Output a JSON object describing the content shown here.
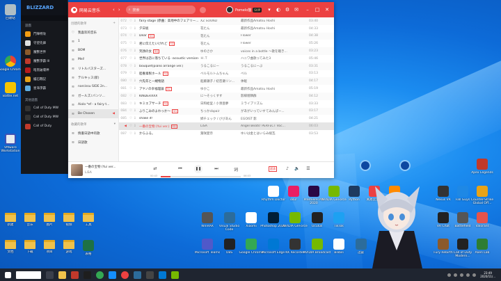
{
  "blizzard": {
    "logo": "BLIZZARD",
    "top_label": "遊戲",
    "section_games": "遊戲",
    "games": [
      {
        "label": "鬥陣特攻",
        "color": "#f39c12"
      },
      {
        "label": "守望先鋒",
        "color": "#e0e0e0"
      },
      {
        "label": "魔獸世界",
        "color": "#8b5a2b"
      },
      {
        "label": "魔獸爭霸 III",
        "color": "#c0392b"
      },
      {
        "label": "暗黑破壞神",
        "color": "#b71c1c"
      },
      {
        "label": "爐石戰記",
        "color": "#e8a317"
      },
      {
        "label": "星海爭霸",
        "color": "#5dade2"
      }
    ],
    "section_other": "其他遊戲",
    "other_games": [
      {
        "label": "Call of Duty MW",
        "color": "#333333"
      },
      {
        "label": "Call of Duty MW",
        "color": "#333333"
      },
      {
        "label": "Call of Duty",
        "color": "#c0392b"
      }
    ]
  },
  "netease": {
    "app_name": "网易云音乐",
    "search_placeholder": "搜索",
    "user_name": "Pomelo猫",
    "vip": "SVIP",
    "sidebar_section_created": "创建的歌单",
    "sidebar_items": [
      {
        "icon": "♡",
        "label": "我喜欢的音乐"
      },
      {
        "icon": "≋",
        "label": "1"
      },
      {
        "icon": "≋",
        "label": "BOM"
      },
      {
        "icon": "≋",
        "label": "Mei!"
      },
      {
        "icon": "≋",
        "label": "リトルバスターズ..."
      },
      {
        "icon": "≋",
        "label": "テルキッス(新)"
      },
      {
        "icon": "≋",
        "label": "narcissu SIDE 2n..."
      },
      {
        "icon": "≋",
        "label": "ガールズ♪バンソ..."
      },
      {
        "icon": "≋",
        "label": "Aiolo *ef - a fairy t..."
      },
      {
        "icon": "≋",
        "label": "Be Chosen"
      }
    ],
    "sidebar_section_collected": "收藏的歌单",
    "sidebar_collected": [
      {
        "icon": "≋",
        "label": "情書日語中的歌"
      },
      {
        "icon": "≋",
        "label": "日語歌"
      }
    ],
    "songs": [
      {
        "no": "072",
        "title": "fairy stage (原曲：高地中のフェアリー...",
        "tag": "",
        "artist": "XZ SOUND",
        "album": "最新作品Amatsu Hoshi",
        "duration": "03:40"
      },
      {
        "no": "073",
        "title": "夕日坂",
        "tag": "",
        "artist": "花たん",
        "album": "最新作品Amatsu Hoshi",
        "duration": "04:33"
      },
      {
        "no": "074",
        "title": "Dear",
        "tag": "SQ",
        "artist": "花たん",
        "album": "Flower",
        "duration": "04:38"
      },
      {
        "no": "075",
        "title": "君に伝えたいけれど",
        "tag": "SQ",
        "artist": "花たん",
        "album": "Flower",
        "duration": "05:26"
      },
      {
        "no": "076",
        "title": "笑顔の女",
        "tag": "SQ",
        "artist": "ゆのさか",
        "album": "voices in a bottle ～歌を聴き...",
        "duration": "03:23"
      },
      {
        "no": "077",
        "title": "世界は恋に落ちている -acoustic version-",
        "tag": "",
        "artist": "Ｈ.Ｔ",
        "album": "ハニワ曲歌ってみた3",
        "duration": "05:46"
      },
      {
        "no": "078",
        "title": "bouquet(piano arrange ver.)",
        "tag": "",
        "artist": "うるこるにー",
        "album": "うるこるにーぶ",
        "duration": "03:31"
      },
      {
        "no": "079",
        "title": "胆養毒製ホール",
        "tag": "SQ",
        "artist": "ベルモルトムちゃん",
        "album": "ベル",
        "duration": "03:13"
      },
      {
        "no": "080",
        "title": "穴先年と一緒物語",
        "tag": "",
        "artist": "船藤瀬子 / 初音瀬リン...",
        "album": "休眠",
        "duration": "04:17"
      },
      {
        "no": "081",
        "title": "アヤノの幸福理論",
        "tag": "SQ",
        "artist": "ゆかこ",
        "album": "最新作品Amatsu Hoshi",
        "duration": "05:19"
      },
      {
        "no": "082",
        "title": "KINDERXXX",
        "tag": "",
        "artist": "に～そっくすす",
        "album": "影縁貌隣群",
        "duration": "04:12"
      },
      {
        "no": "083",
        "title": "キミエブサーチ",
        "tag": "SQ",
        "artist": "日和絵里 / 小湊亜夢",
        "album": "ミライプリズム",
        "duration": "03:33"
      },
      {
        "no": "084",
        "title": "ふりこみのよわっか～",
        "tag": "SQ",
        "artist": "ちっかcbpair",
        "album": "があがいっていすてみんぱー...",
        "duration": "03:17"
      },
      {
        "no": "085",
        "title": "shake it!",
        "tag": "",
        "artist": "姉チェック / びびあん",
        "album": "EGOIST 影",
        "duration": "04:21"
      },
      {
        "no": "086",
        "title": "一番の宝物 (Yui ver.)",
        "tag": "SQ",
        "artist": "LiSA",
        "album": "Angel Beats! PERFECT Voc...",
        "duration": "06:03"
      },
      {
        "no": "087",
        "title": "からふる。",
        "tag": "",
        "artist": "葉咲愛奈",
        "album": "ゆいは金とはいらみ綾瓦",
        "duration": "03:53"
      }
    ],
    "playing_index": 14,
    "player": {
      "title": "一番の宝物 (Yui ver...",
      "artist": "LiSA",
      "current": "00:43",
      "total": "06:03",
      "progress": 0.12,
      "quality": "超清"
    }
  },
  "desktop": {
    "left_icons": [
      {
        "label": "回收站",
        "color": "#b0bec5"
      },
      {
        "label": "Google Chrome",
        "color": "#34a853"
      },
      {
        "label": "Battle.net",
        "color": "#148eff"
      },
      {
        "label": "VMware Workstation",
        "color": "#e7ecf0"
      }
    ],
    "center_icons_row1": [
      {
        "label": "Rhythm Doctor",
        "color": "#ffffff"
      },
      {
        "label": "osu!",
        "color": "#e91e63"
      },
      {
        "label": "Premiere Pro 2020",
        "color": "#2a0845"
      },
      {
        "label": "NVIDIA GeForce",
        "color": "#76b900"
      },
      {
        "label": "Python",
        "color": "#1e3a5f"
      },
      {
        "label": "网易云音乐",
        "color": "#ec4141"
      },
      {
        "label": "Steam",
        "color": "#ff8a00"
      }
    ],
    "center_icons_row2": [
      {
        "label": "WinRAR",
        "color": "#555555"
      },
      {
        "label": "Visual Studio Code",
        "color": "#2c6c9b"
      },
      {
        "label": "Xiaomi",
        "color": "#ffffff"
      },
      {
        "label": "Photoshop 2020",
        "color": "#001e36"
      },
      {
        "label": "NVIDIA GeForce",
        "color": "#76b900"
      },
      {
        "label": "Oculus",
        "color": "#222222"
      },
      {
        "label": "TikTok",
        "color": "#1da1f2"
      }
    ],
    "center_icons_row3": [
      {
        "label": "Microsoft Teams",
        "color": "#5059c9"
      },
      {
        "label": "OBS",
        "color": "#222222"
      },
      {
        "label": "Google Chrome",
        "color": "#34a853"
      },
      {
        "label": "Microsoft Edge",
        "color": "#0078d4"
      },
      {
        "label": "KK Recorder",
        "color": "#333333"
      },
      {
        "label": "NVIDIA Broadcast",
        "color": "#76b900"
      },
      {
        "label": "Bilibili",
        "color": "#ffffff"
      },
      {
        "label": "迅雷",
        "color": "#2c6c9b"
      }
    ],
    "right_icons": [
      {
        "label": "Apex Legends",
        "color": "#c0392b"
      },
      {
        "label": "Nexus VR",
        "color": "#333333"
      },
      {
        "label": "Fall Guys",
        "color": "#1e88e5"
      },
      {
        "label": "Counter-Strike Global Off...",
        "color": "#e8a317"
      },
      {
        "label": "VR Chat",
        "color": "#222222"
      },
      {
        "label": "Battlefield",
        "color": "#555555"
      },
      {
        "label": "Valorant",
        "color": "#e5534b"
      },
      {
        "label": "Fury Rebirth",
        "color": "#8b5a2b"
      },
      {
        "label": "Call of Duty Modern...",
        "color": "#222222"
      },
      {
        "label": "Alien Lab",
        "color": "#2e7d32"
      }
    ],
    "folders": [
      {
        "label": "新建"
      },
      {
        "label": "音乐"
      },
      {
        "label": "图片"
      },
      {
        "label": "视频"
      },
      {
        "label": "工具"
      },
      {
        "label": "文档"
      },
      {
        "label": "下载"
      },
      {
        "label": "项目"
      },
      {
        "label": "游戏"
      },
      {
        "label": "表格"
      }
    ]
  },
  "taskbar": {
    "time": "23:49",
    "date": "2020/11/..."
  }
}
